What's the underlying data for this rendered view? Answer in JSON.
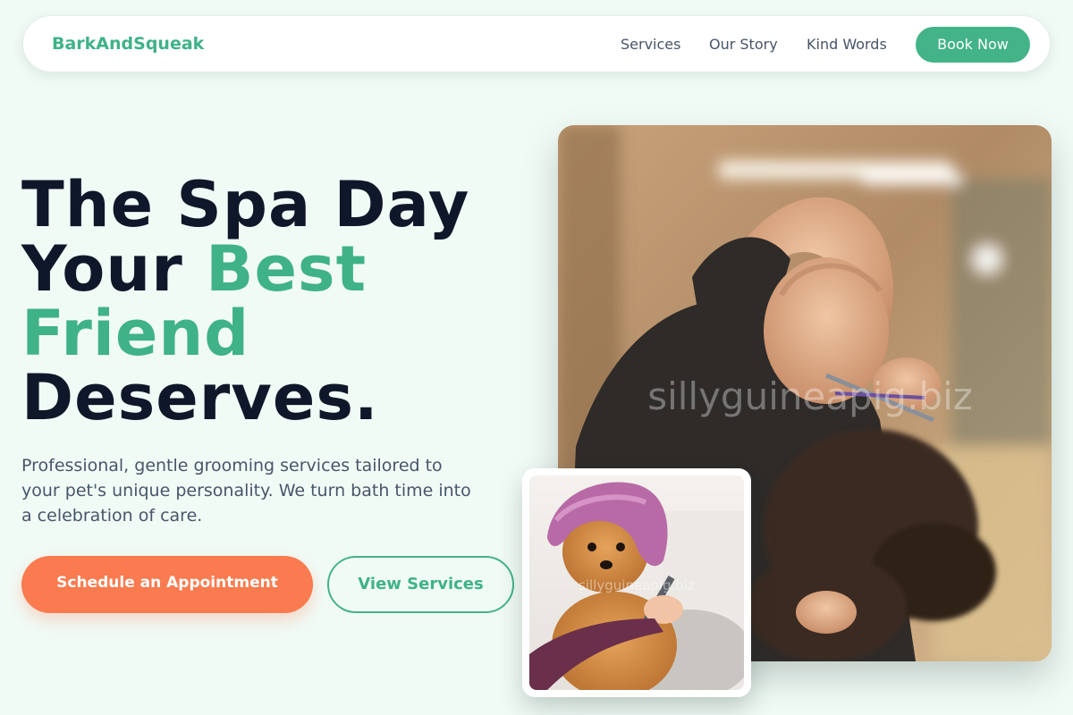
{
  "nav": {
    "brand": "BarkAndSqueak",
    "links": [
      "Services",
      "Our Story",
      "Kind Words"
    ],
    "cta": "Book Now"
  },
  "hero": {
    "title_line1": "The Spa Day",
    "title_line2_plain": "Your ",
    "title_line2_accent": "Best",
    "title_line3_accent": "Friend",
    "title_line4": "Deserves.",
    "subtitle": "Professional, gentle grooming services tailored to your pet's unique personality. We turn bath time into a celebration of care.",
    "primary_cta": "Schedule an Appointment",
    "secondary_cta": "View Services"
  },
  "images": {
    "main_watermark": "sillyguineapig.biz",
    "small_watermark": "sillyguineapig.biz"
  },
  "colors": {
    "brand_green": "#3fb287",
    "primary_orange": "#f97b4f",
    "background": "#f1fbf6",
    "heading_dark": "#0f172a"
  }
}
